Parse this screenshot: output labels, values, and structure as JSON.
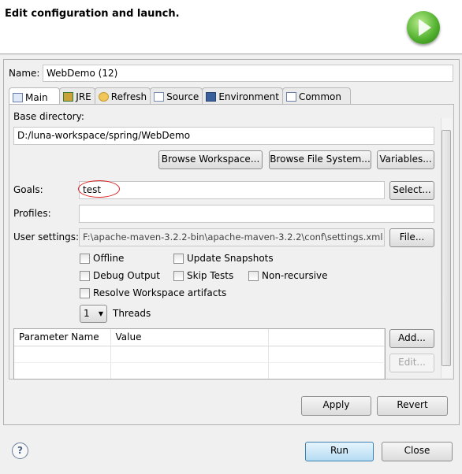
{
  "header": {
    "title": "Edit configuration and launch.",
    "icon": "run-launch-icon"
  },
  "name": {
    "label": "Name:",
    "value": "WebDemo (12)"
  },
  "tabs": [
    {
      "label": "Main",
      "icon": "main-tab-icon"
    },
    {
      "label": "JRE",
      "icon": "jre-books-icon"
    },
    {
      "label": "Refresh",
      "icon": "refresh-icon"
    },
    {
      "label": "Source",
      "icon": "source-icon"
    },
    {
      "label": "Environment",
      "icon": "environment-icon"
    },
    {
      "label": "Common",
      "icon": "common-icon"
    }
  ],
  "main": {
    "base_directory_label": "Base directory:",
    "base_directory_value": "D:/luna-workspace/spring/WebDemo",
    "browse_workspace": "Browse Workspace...",
    "browse_file_system": "Browse File System...",
    "variables": "Variables...",
    "goals_label": "Goals:",
    "goals_value": "test",
    "select": "Select...",
    "profiles_label": "Profiles:",
    "profiles_value": "",
    "user_settings_label": "User settings:",
    "user_settings_value": "F:\\apache-maven-3.2.2-bin\\apache-maven-3.2.2\\conf\\settings.xml",
    "file": "File...",
    "checkboxes": {
      "offline": "Offline",
      "update_snapshots": "Update Snapshots",
      "debug_output": "Debug Output",
      "skip_tests": "Skip Tests",
      "non_recursive": "Non-recursive",
      "resolve_workspace": "Resolve Workspace artifacts"
    },
    "threads_value": "1",
    "threads_label": "Threads",
    "table": {
      "columns": [
        "Parameter Name",
        "Value",
        ""
      ]
    },
    "add": "Add...",
    "edit": "Edit..."
  },
  "apply": "Apply",
  "revert": "Revert",
  "run": "Run",
  "close": "Close",
  "help": "?"
}
